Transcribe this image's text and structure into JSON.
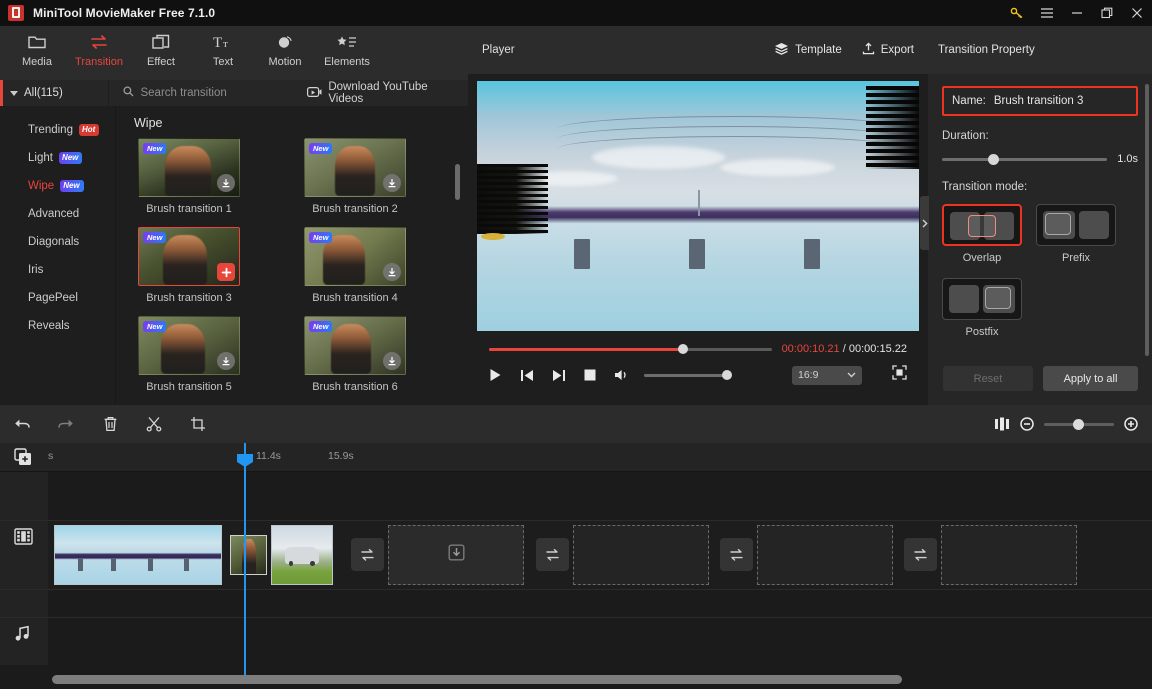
{
  "titlebar": {
    "app_title": "MiniTool MovieMaker Free 7.1.0",
    "logo_name": "minitool-logo",
    "buttons": [
      {
        "name": "key-icon",
        "label": "key"
      },
      {
        "name": "menu-icon",
        "label": "menu"
      },
      {
        "name": "minimize-icon",
        "label": "minimize"
      },
      {
        "name": "restore-icon",
        "label": "restore"
      },
      {
        "name": "close-icon",
        "label": "close"
      }
    ]
  },
  "toolbar": {
    "items": [
      {
        "label": "Media",
        "icon": "folder-icon",
        "active": false
      },
      {
        "label": "Transition",
        "icon": "transition-icon",
        "active": true
      },
      {
        "label": "Effect",
        "icon": "effect-icon",
        "active": false
      },
      {
        "label": "Text",
        "icon": "text-icon",
        "active": false
      },
      {
        "label": "Motion",
        "icon": "motion-icon",
        "active": false
      },
      {
        "label": "Elements",
        "icon": "elements-icon",
        "active": false
      }
    ]
  },
  "library": {
    "all_label": "All(115)",
    "search_placeholder": "Search transition",
    "download_youtube_label": "Download YouTube Videos",
    "categories": [
      {
        "label": "Trending",
        "badge": "Hot",
        "badge_type": "hot",
        "active": false
      },
      {
        "label": "Light",
        "badge": "New",
        "badge_type": "new",
        "active": false
      },
      {
        "label": "Wipe",
        "badge": "New",
        "badge_type": "new",
        "active": true
      },
      {
        "label": "Advanced",
        "badge": "",
        "badge_type": "",
        "active": false
      },
      {
        "label": "Diagonals",
        "badge": "",
        "badge_type": "",
        "active": false
      },
      {
        "label": "Iris",
        "badge": "",
        "badge_type": "",
        "active": false
      },
      {
        "label": "PagePeel",
        "badge": "",
        "badge_type": "",
        "active": false
      },
      {
        "label": "Reveals",
        "badge": "",
        "badge_type": "",
        "active": false
      }
    ],
    "group_title": "Wipe",
    "items": [
      {
        "label": "Brush transition 1",
        "badge": "New",
        "action": "download-icon",
        "selected": false
      },
      {
        "label": "Brush transition 2",
        "badge": "New",
        "action": "download-icon",
        "selected": false
      },
      {
        "label": "Brush transition 3",
        "badge": "New",
        "action": "add-icon",
        "selected": true
      },
      {
        "label": "Brush transition 4",
        "badge": "New",
        "action": "download-icon",
        "selected": false
      },
      {
        "label": "Brush transition 5",
        "badge": "New",
        "action": "download-icon",
        "selected": false
      },
      {
        "label": "Brush transition 6",
        "badge": "New",
        "action": "download-icon",
        "selected": false
      }
    ]
  },
  "player": {
    "title": "Player",
    "template_label": "Template",
    "export_label": "Export",
    "current_time": "00:00:10.21",
    "separator": "/",
    "total_time": "00:00:15.22",
    "aspect_ratio": "16:9",
    "progress_percent": 68.5,
    "controls": [
      {
        "name": "play-button",
        "label": "play"
      },
      {
        "name": "previous-frame-button",
        "label": "previous"
      },
      {
        "name": "next-frame-button",
        "label": "next"
      },
      {
        "name": "stop-button",
        "label": "stop"
      },
      {
        "name": "volume-button",
        "label": "volume"
      }
    ]
  },
  "transition_property": {
    "title": "Transition Property",
    "name_label": "Name:",
    "name_value": "Brush transition 3",
    "duration_label": "Duration:",
    "duration_value": "1.0s",
    "mode_label": "Transition mode:",
    "modes": [
      {
        "label": "Overlap",
        "selected": true
      },
      {
        "label": "Prefix",
        "selected": false
      },
      {
        "label": "Postfix",
        "selected": false
      }
    ],
    "reset_label": "Reset",
    "apply_label": "Apply to all",
    "collapse_icon": "chevron-right-icon"
  },
  "timeline": {
    "tools": [
      {
        "name": "undo-button",
        "label": "undo"
      },
      {
        "name": "redo-button",
        "label": "redo"
      },
      {
        "name": "delete-button",
        "label": "delete"
      },
      {
        "name": "split-button",
        "label": "split"
      },
      {
        "name": "crop-button",
        "label": "crop"
      }
    ],
    "fit_icon": "fit-timeline-icon",
    "zoom_out_icon": "zoom-out-icon",
    "zoom_in_icon": "zoom-in-icon",
    "ruler_labels": [
      "s",
      "11.4s",
      "15.9s"
    ],
    "add_track_icon": "add-media-icon",
    "video_track_icon": "film-icon",
    "audio_track_icon": "music-icon",
    "transition_slot_icon": "transition-swap-icon",
    "import_slot_icon": "import-down-icon"
  },
  "colors": {
    "accent_red": "#e8453c",
    "highlight_red": "#ee3322",
    "playhead_blue": "#2196f3",
    "badge_new_from": "#7a3bf2",
    "badge_new_to": "#2a7cf6",
    "badge_hot": "#d63a30"
  }
}
